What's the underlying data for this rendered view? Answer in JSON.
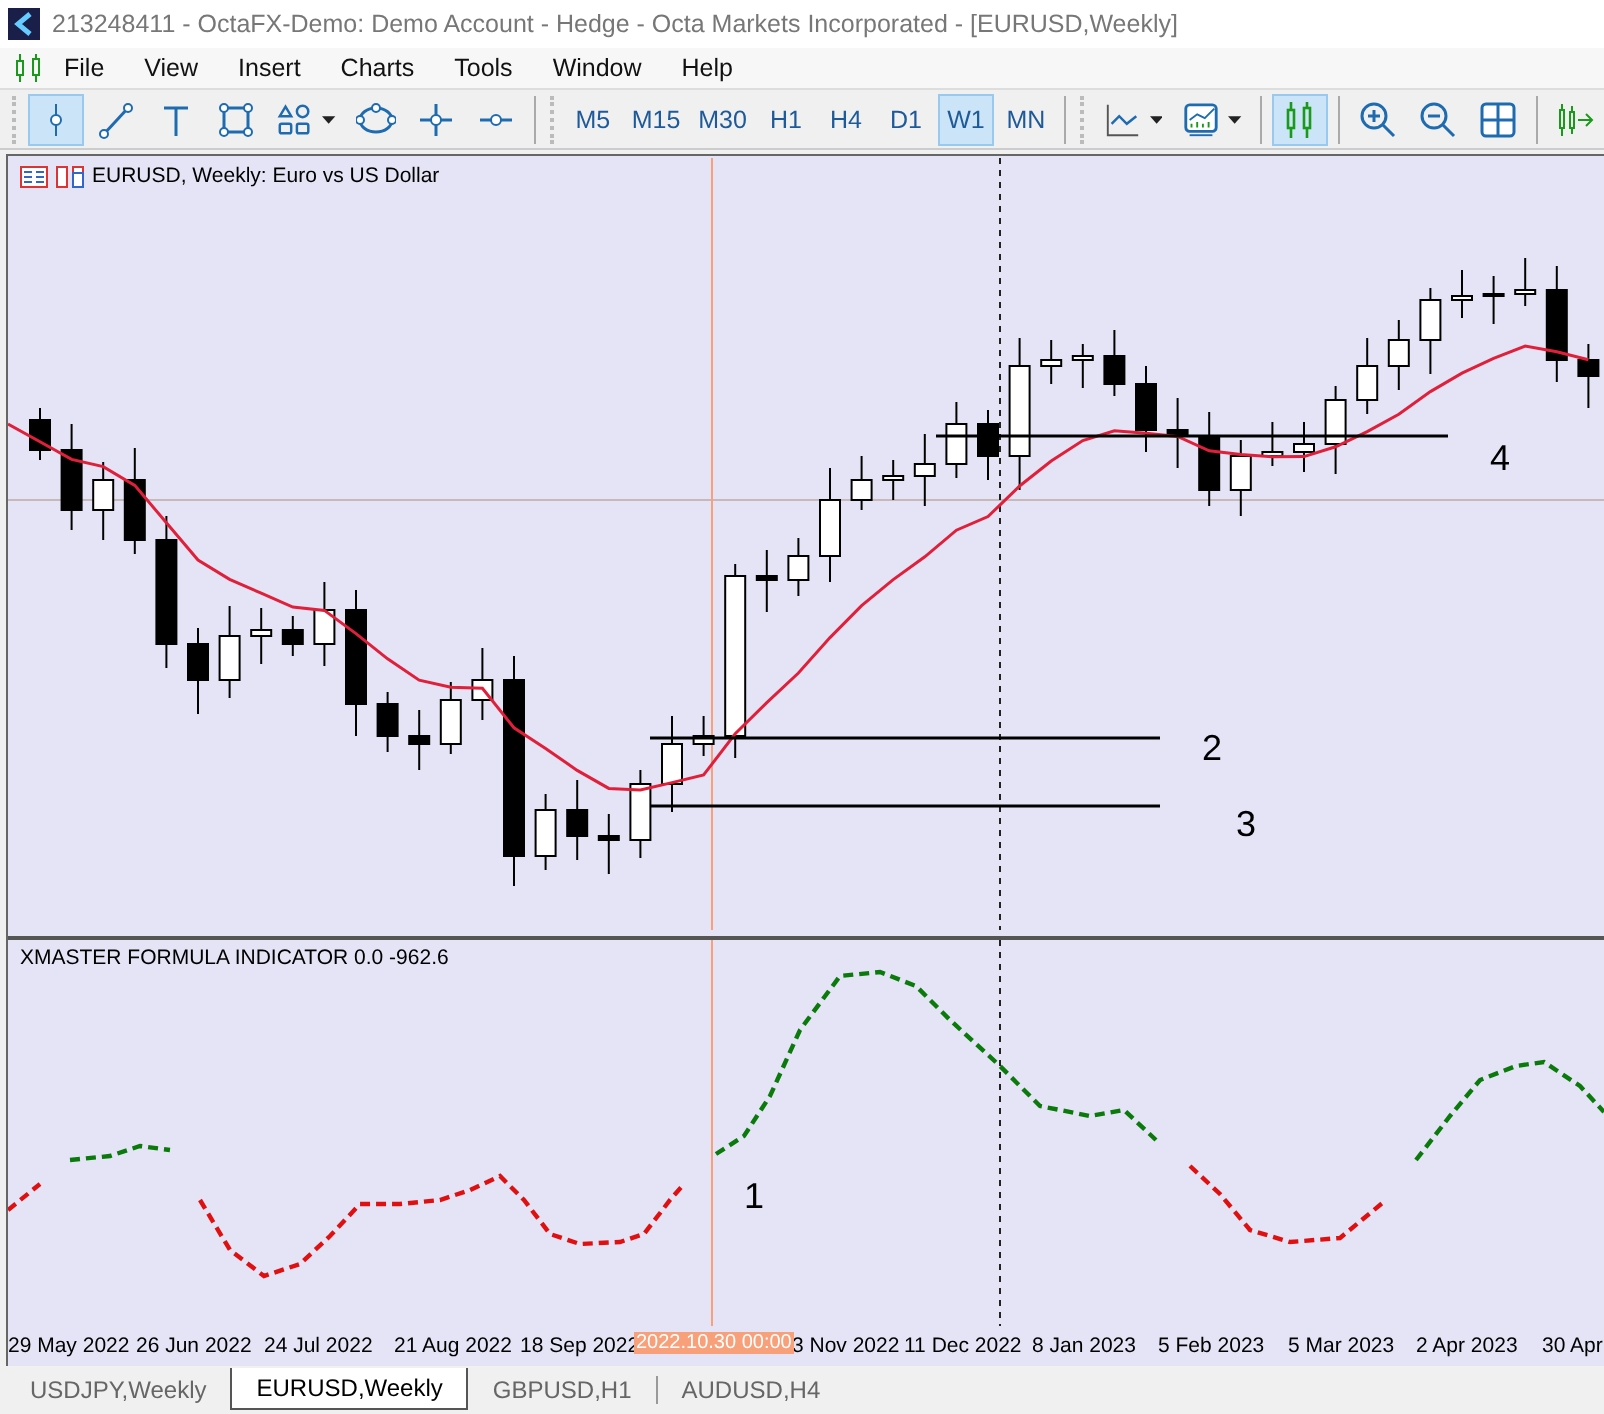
{
  "window": {
    "title": "213248411 - OctaFX-Demo: Demo Account - Hedge - Octa Markets Incorporated - [EURUSD,Weekly]"
  },
  "menu": [
    "File",
    "View",
    "Insert",
    "Charts",
    "Tools",
    "Window",
    "Help"
  ],
  "toolbar": {
    "tools": [
      {
        "kind": "cursor",
        "selected": true
      },
      {
        "kind": "trendline",
        "selected": false
      },
      {
        "kind": "text",
        "selected": false
      },
      {
        "kind": "rectangle",
        "selected": false
      },
      {
        "kind": "shapes",
        "selected": false
      },
      {
        "kind": "ellipse",
        "selected": false
      },
      {
        "kind": "crosshair",
        "selected": false
      },
      {
        "kind": "hline",
        "selected": false
      }
    ],
    "timeframes": [
      {
        "label": "M5",
        "selected": false
      },
      {
        "label": "M15",
        "selected": false
      },
      {
        "label": "M30",
        "selected": false
      },
      {
        "label": "H1",
        "selected": false
      },
      {
        "label": "H4",
        "selected": false
      },
      {
        "label": "D1",
        "selected": false
      },
      {
        "label": "W1",
        "selected": true
      },
      {
        "label": "MN",
        "selected": false
      }
    ],
    "views": [
      {
        "kind": "linechart",
        "selected": false
      },
      {
        "kind": "indicators",
        "selected": false
      },
      {
        "kind": "candles",
        "selected": true
      },
      {
        "kind": "zoomin",
        "selected": false
      },
      {
        "kind": "zoomout",
        "selected": false
      },
      {
        "kind": "tile",
        "selected": false
      },
      {
        "kind": "autoscroll",
        "selected": false
      }
    ]
  },
  "chart": {
    "title": "EURUSD, Weekly:  Euro vs US Dollar",
    "annotations": [
      "2",
      "3",
      "4"
    ]
  },
  "indicator": {
    "title": "XMASTER FORMULA INDICATOR 0.0 -962.6",
    "annotation": "1"
  },
  "time_axis": {
    "labels": [
      "29 May 2022",
      "26 Jun 2022",
      "24 Jul 2022",
      "21 Aug 2022",
      "18 Sep 2022",
      "3 Nov 2022",
      "11 Dec 2022",
      "8 Jan 2023",
      "5 Feb 2023",
      "5 Mar 2023",
      "2 Apr 2023",
      "30 Apr"
    ],
    "crosshair_label": "2022.10.30 00:00"
  },
  "tabs": [
    {
      "label": "USDJPY,Weekly",
      "selected": false
    },
    {
      "label": "EURUSD,Weekly",
      "selected": true
    },
    {
      "label": "GBPUSD,H1",
      "selected": false
    },
    {
      "label": "AUDUSD,H4",
      "selected": false
    }
  ]
}
